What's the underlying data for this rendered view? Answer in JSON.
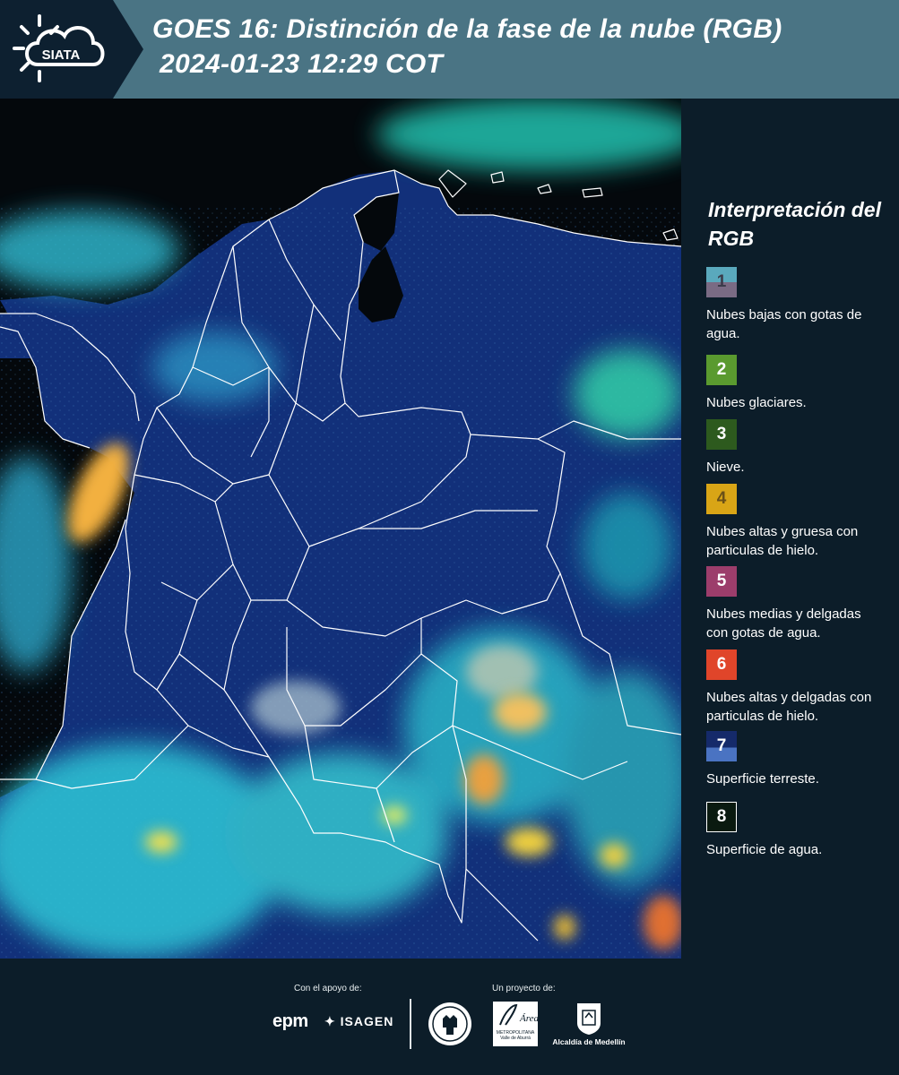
{
  "header": {
    "title_line1": "GOES 16: Distinción de la fase de la nube (RGB)",
    "title_line2": "2024-01-23 12:29 COT",
    "logo_text": "SIATA",
    "background_color": "#4a7484"
  },
  "legend": {
    "title": "Interpretación del RGB",
    "items": [
      {
        "number": "1",
        "label": "Nubes bajas con gotas de agua.",
        "colors": [
          "#5aa9bd",
          "#7a6b84"
        ]
      },
      {
        "number": "2",
        "label": "Nubes glaciares.",
        "colors": [
          "#5a9a2f"
        ]
      },
      {
        "number": "3",
        "label": "Nieve.",
        "colors": [
          "#2d5a1e"
        ]
      },
      {
        "number": "4",
        "label": "Nubes altas y gruesa con particulas de hielo.",
        "colors": [
          "#d9a516"
        ]
      },
      {
        "number": "5",
        "label": "Nubes medias y delgadas con gotas de agua.",
        "colors": [
          "#9c3d6b"
        ]
      },
      {
        "number": "6",
        "label": "Nubes altas y delgadas con particulas de hielo.",
        "colors": [
          "#e0452a"
        ]
      },
      {
        "number": "7",
        "label": "Superficie terreste.",
        "colors": [
          "#152a6a",
          "#4a73c2"
        ]
      },
      {
        "number": "8",
        "label": "Superficie de agua.",
        "colors": [
          "#0a1a10"
        ]
      }
    ]
  },
  "footer": {
    "support_caption": "Con el apoyo de:",
    "project_caption": "Un proyecto de:",
    "sponsors": [
      "epm",
      "ISAGEN"
    ],
    "partners": [
      "Área Metropolitana Valle de Aburrá",
      "Alcaldía de Medellín"
    ],
    "area_logo_text": "METROPOLITANA\nValle de Aburrá",
    "medellin_label": "Alcaldía de Medellín"
  },
  "map": {
    "land_color": "#14307a",
    "water_color": "#04080c",
    "border_color": "#ffffff"
  }
}
